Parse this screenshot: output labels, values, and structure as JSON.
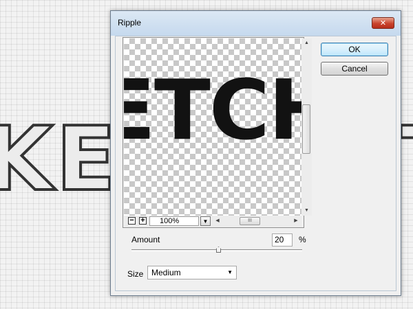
{
  "background": {
    "word_left": "KE",
    "word_right": "T"
  },
  "dialog": {
    "title": "Ripple",
    "close_symbol": "✕",
    "preview": {
      "text": "ETCH",
      "zoom_value": "100%",
      "zoom_out_symbol": "−",
      "zoom_in_symbol": "+",
      "dropdown_symbol": "▼",
      "hthumb_symbol": "III"
    },
    "buttons": {
      "ok": "OK",
      "cancel": "Cancel"
    },
    "amount": {
      "label": "Amount",
      "value": "20",
      "unit": "%"
    },
    "size": {
      "label": "Size",
      "value": "Medium",
      "caret": "▼"
    }
  },
  "colors": {
    "accent": "#3c7fb1",
    "close": "#c9432c"
  }
}
